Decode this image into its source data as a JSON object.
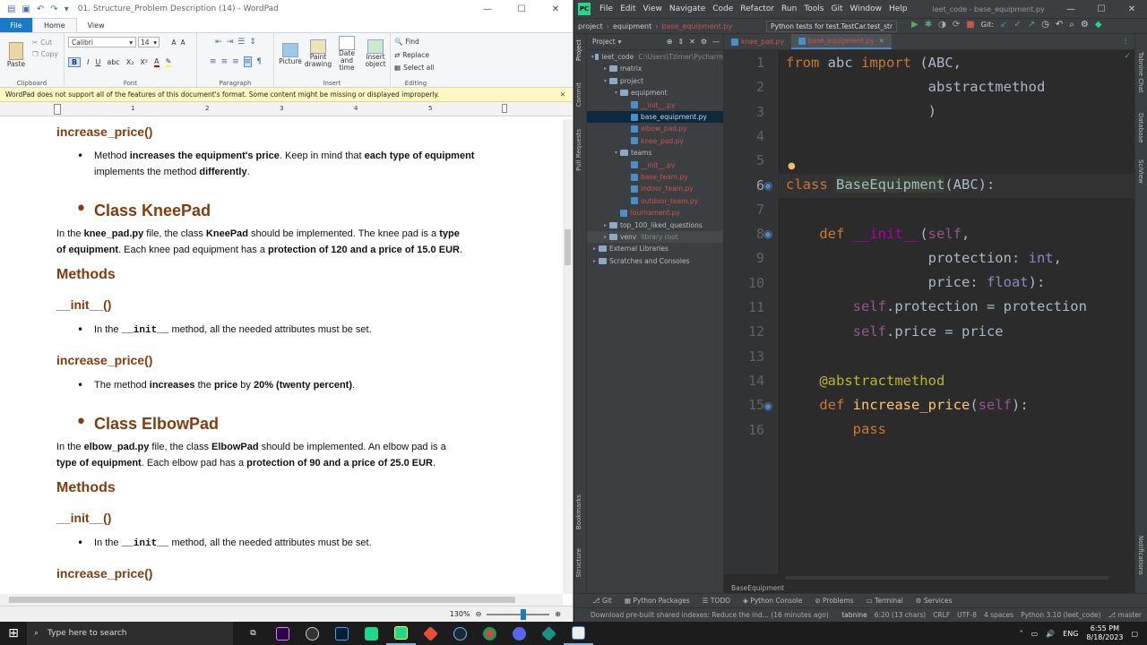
{
  "wordpad": {
    "title": "01. Structure_Problem Description (14) - WordPad",
    "tabs": {
      "file": "File",
      "home": "Home",
      "view": "View"
    },
    "ribbon": {
      "clipboard": {
        "label": "Clipboard",
        "paste": "Paste",
        "cut": "Cut",
        "copy": "Copy"
      },
      "font": {
        "label": "Font",
        "family": "Calibri",
        "size": "14"
      },
      "paragraph": {
        "label": "Paragraph"
      },
      "insert": {
        "label": "Insert",
        "picture": "Picture",
        "paint": "Paint drawing",
        "datetime": "Date and time",
        "object": "Insert object"
      },
      "editing": {
        "label": "Editing",
        "find": "Find",
        "replace": "Replace",
        "selectall": "Select all"
      }
    },
    "infobar": "WordPad does not support all of the features of this document's format. Some content might be missing or displayed improperly.",
    "ruler": [
      "1",
      "2",
      "3",
      "4",
      "5"
    ],
    "doc": {
      "h_inc1": "increase_price()",
      "b1": {
        "a": "Method ",
        "b": "increases the equipment's price",
        "c": ". Keep in mind that ",
        "d": "each type of equipment",
        "e": "implements  the method  ",
        "f": "differently",
        "g": "."
      },
      "knee_h": "Class KneePad",
      "knee": {
        "a": "In  the  ",
        "b": "knee_pad.py",
        "c": "  file,  the  class  ",
        "d": "KneePad",
        "e": "  should  be  implemented.  The  knee  pad  is  a  ",
        "f": "type",
        "g": "of equipment",
        "h": ".  Each knee  pad equipment   has a ",
        "i": "protection of 120 and a price of 15.0 EUR",
        "j": "."
      },
      "methods1": "Methods",
      "init1": "__init__()",
      "init1_text": {
        "a": "In the ",
        "b": "__init__",
        "c": " method,  all the  needed  attributes  must be set."
      },
      "inc2": "increase_price()",
      "inc2_text": {
        "a": "The method  ",
        "b": "increases",
        "c": " the ",
        "d": "price",
        "e": " by ",
        "f": "20% (twenty percent)",
        "g": "."
      },
      "elbow_h": "Class ElbowPad",
      "elbow": {
        "a": "In  the  ",
        "b": "elbow_pad.py",
        "c": "  file,  the  class  ",
        "d": "ElbowPad",
        "e": "  should  be  implemented.  An  elbow  pad  is  a",
        "f": "type of equipment",
        "g": ".  Each elbow  pad has a ",
        "h": "protection of 90 and a price of 25.0 EUR",
        "i": "."
      },
      "methods2": "Methods",
      "init2": "__init__()",
      "init2_text": {
        "a": "In the ",
        "b": "__init__",
        "c": " method,  all the  needed  attributes  must be set."
      },
      "inc3": "increase_price()"
    },
    "zoom": "130%"
  },
  "pycharm": {
    "menu": [
      "File",
      "Edit",
      "View",
      "Navigate",
      "Code",
      "Refactor",
      "Run",
      "Tools",
      "Git",
      "Window",
      "Help"
    ],
    "title": "leet_code - base_equipment.py",
    "breadcrumb": [
      "project",
      "equipment",
      "base_equipment.py"
    ],
    "run_config": "Python tests for test.TestCar.test_str",
    "git_label": "Git:",
    "project_label": "Project",
    "tree": [
      {
        "label": "leet_code",
        "extra": "C:\\Users\\Tzimer\\Pycharm",
        "depth": 0,
        "type": "folder"
      },
      {
        "label": "matrix",
        "depth": 1,
        "type": "folder"
      },
      {
        "label": "project",
        "depth": 1,
        "type": "folder"
      },
      {
        "label": "equipment",
        "depth": 2,
        "type": "folder"
      },
      {
        "label": "__init__.py",
        "depth": 3,
        "type": "file"
      },
      {
        "label": "base_equipment.py",
        "depth": 3,
        "type": "file"
      },
      {
        "label": "elbow_pad.py",
        "depth": 3,
        "type": "file"
      },
      {
        "label": "knee_pad.py",
        "depth": 3,
        "type": "file"
      },
      {
        "label": "teams",
        "depth": 2,
        "type": "folder"
      },
      {
        "label": "__init__.py",
        "depth": 3,
        "type": "file"
      },
      {
        "label": "base_team.py",
        "depth": 3,
        "type": "file"
      },
      {
        "label": "indoor_team.py",
        "depth": 3,
        "type": "file"
      },
      {
        "label": "outdoor_team.py",
        "depth": 3,
        "type": "file"
      },
      {
        "label": "tournament.py",
        "depth": 2,
        "type": "file"
      },
      {
        "label": "top_100_liked_questions",
        "depth": 1,
        "type": "folder"
      },
      {
        "label": "venv",
        "extra": "library root",
        "depth": 1,
        "type": "folder"
      },
      {
        "label": "External Libraries",
        "depth": 0,
        "type": "lib"
      },
      {
        "label": "Scratches and Consoles",
        "depth": 0,
        "type": "lib"
      }
    ],
    "tabs": [
      "knee_pad.py",
      "base_equipment.py"
    ],
    "line_numbers": [
      "1",
      "2",
      "3",
      "4",
      "5",
      "6",
      "7",
      "8",
      "9",
      "10",
      "11",
      "12",
      "13",
      "14",
      "15",
      "16"
    ],
    "code_breadcrumb": "BaseEquipment",
    "tool_windows": [
      "Git",
      "Python Packages",
      "TODO",
      "Python Console",
      "Problems",
      "Terminal",
      "Services"
    ],
    "left_strip": [
      "Project",
      "Commit",
      "Pull Requests",
      "Bookmarks",
      "Structure"
    ],
    "right_strip": [
      "Tabnine Chat",
      "Database",
      "SciView",
      "Notifications"
    ],
    "status": {
      "msg": "Download pre-built shared indexes: Reduce the ind... (16 minutes ago)",
      "tabnine": "tabnine",
      "pos": "6:20 (13 chars)",
      "crlf": "CRLF",
      "enc": "UTF-8",
      "indent": "4 spaces",
      "interp": "Python 3.10 (leet_code)",
      "branch": "master"
    }
  },
  "taskbar": {
    "search": "Type here to search",
    "lang": "ENG",
    "time": "6:55 PM",
    "date": "8/18/2023"
  }
}
